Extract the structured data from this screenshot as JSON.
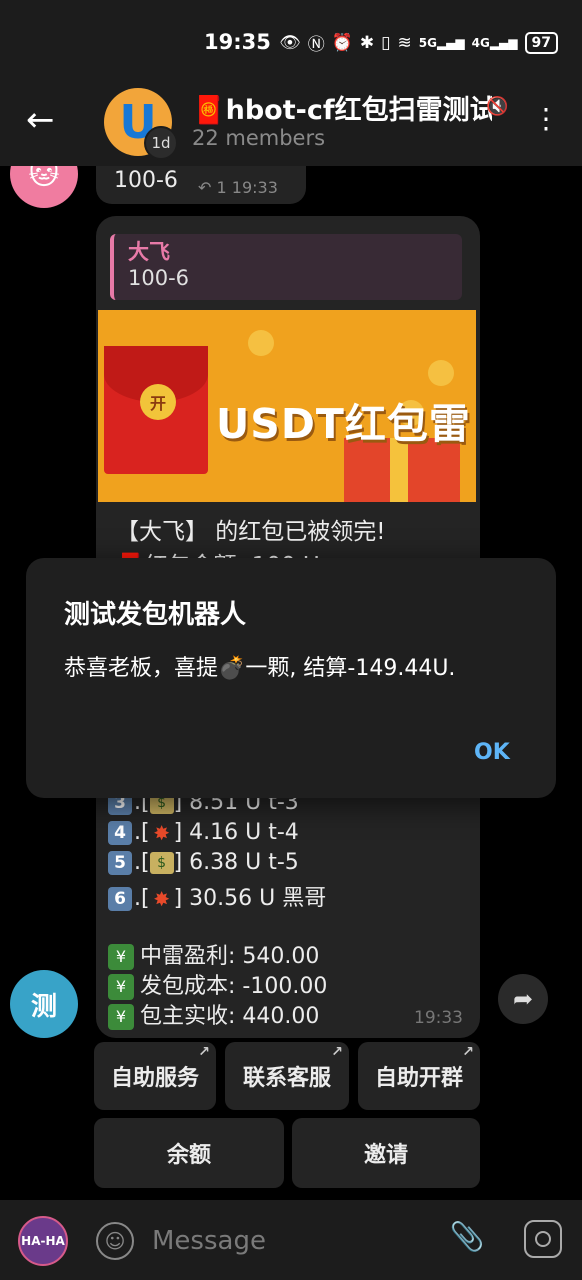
{
  "status_bar": {
    "time": "19:35",
    "icons": [
      "eye-icon",
      "nfc-icon",
      "alarm-icon",
      "bluetooth-icon",
      "vibrate-icon",
      "wifi-icon",
      "signal-5g-icon",
      "signal-4g-icon"
    ],
    "signal_5g": "5G",
    "signal_4g": "4G",
    "battery": "97"
  },
  "header": {
    "avatar_letter": "U",
    "timer_badge": "1d",
    "title": "hbot-cf红包扫雷测试",
    "members": "22 members"
  },
  "previous_message": {
    "text": "100-6",
    "reply_count": "1",
    "time": "19:33"
  },
  "bot_message": {
    "reply_to_name": "大飞",
    "reply_to_text": "100-6",
    "banner_coin": "开",
    "banner_title": "USDT红包雷",
    "line1": "【大飞】 的红包已被领完!",
    "line2_partial": "红包金额: 100 U",
    "grabs": [
      {
        "num": "3",
        "icon": "money",
        "text": "8.51  U t-3"
      },
      {
        "num": "4",
        "icon": "boom",
        "text": "4.16  U t-4"
      },
      {
        "num": "5",
        "icon": "money",
        "text": "6.38  U t-5"
      },
      {
        "num": "6",
        "icon": "boom",
        "text": "30.56  U 黑哥"
      }
    ],
    "summary": [
      {
        "label": "中雷盈利:",
        "value": "540.00"
      },
      {
        "label": "发包成本:",
        "value": "-100.00"
      },
      {
        "label": "包主实收:",
        "value": "440.00"
      }
    ],
    "time": "19:33",
    "sender_avatar_letter": "测"
  },
  "inline_keyboard": {
    "row1": [
      "自助服务",
      "联系客服",
      "自助开群"
    ],
    "row2": [
      "余额",
      "邀请"
    ]
  },
  "dialog": {
    "title": "测试发包机器人",
    "body_before": "恭喜老板，喜提",
    "body_after": "一颗, 结算-149.44U.",
    "ok": "OK"
  },
  "input_bar": {
    "self_avatar_text": "HA-HA",
    "placeholder": "Message"
  }
}
